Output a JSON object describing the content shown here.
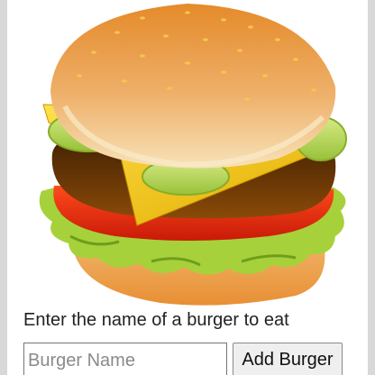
{
  "illustration": {
    "icon": "hamburger-illustration",
    "colors": {
      "bun": "#e8a04c",
      "bun_top_highlight": "#f4d9a6",
      "cheese": "#f2c400",
      "patty": "#6b3a06",
      "tomato": "#e82a10",
      "lettuce": "#9ccc33",
      "pickle": "#c5df68"
    }
  },
  "form": {
    "prompt_text": "Enter the name of a burger to eat",
    "input_placeholder": "Burger Name",
    "input_value": "",
    "submit_label": "Add Burger"
  }
}
